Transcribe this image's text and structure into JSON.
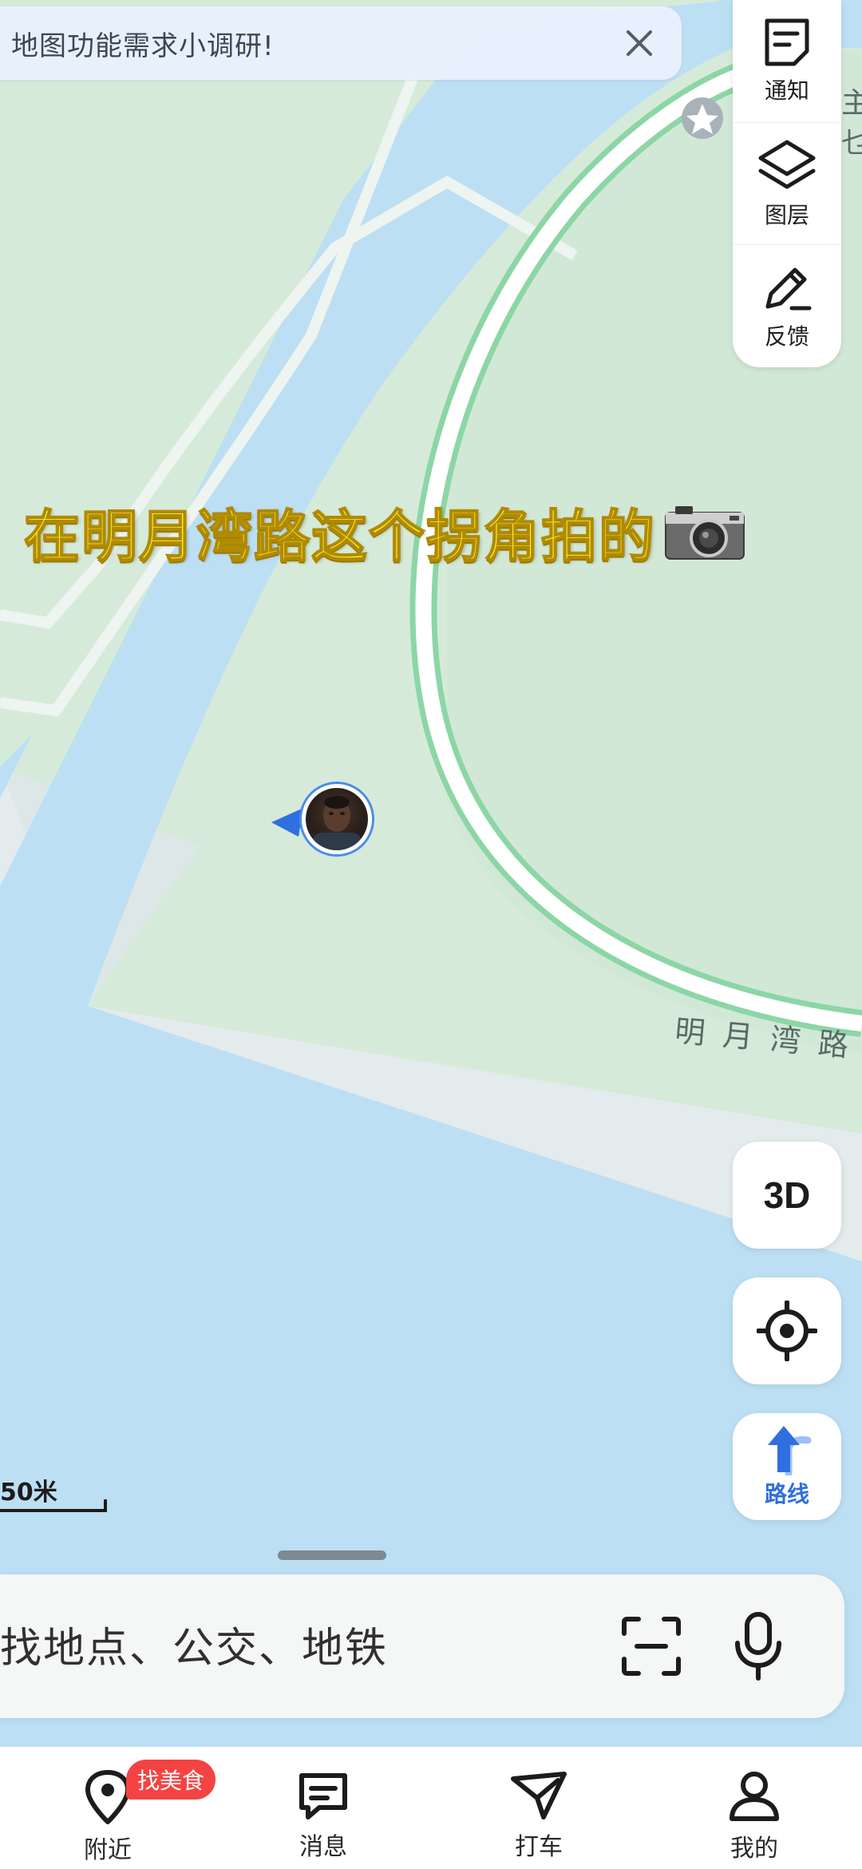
{
  "banner": {
    "text": "地图功能需求小调研!",
    "close_icon": "close-icon"
  },
  "toolbar": {
    "items": [
      {
        "label": "通知",
        "icon": "notice-icon"
      },
      {
        "label": "图层",
        "icon": "layers-icon"
      },
      {
        "label": "反馈",
        "icon": "feedback-pen-icon"
      }
    ]
  },
  "map": {
    "caption": "在明月湾路这个拐角拍的",
    "caption_emoji": "camera-emoji",
    "road_name": "明月湾路",
    "edge_label_1": "主",
    "edge_label_2": "乜",
    "colors": {
      "land": "#d6ead9",
      "water": "#bcdff4",
      "road_edge": "#8cd6a6",
      "plaza": "#e4ebec",
      "path": "#eef3ef"
    }
  },
  "controls": {
    "btn_3d": "3D",
    "locate_icon": "locate-icon",
    "route_label": "路线"
  },
  "scale": {
    "label": "50米"
  },
  "search": {
    "placeholder": "找地点、公交、地铁",
    "scan_icon": "scan-icon",
    "mic_icon": "mic-icon"
  },
  "nav": {
    "badge": "找美食",
    "items": [
      {
        "label": "附近",
        "icon": "nearby-pin-icon"
      },
      {
        "label": "消息",
        "icon": "message-icon"
      },
      {
        "label": "打车",
        "icon": "taxi-icon"
      },
      {
        "label": "我的",
        "icon": "profile-icon"
      }
    ]
  }
}
